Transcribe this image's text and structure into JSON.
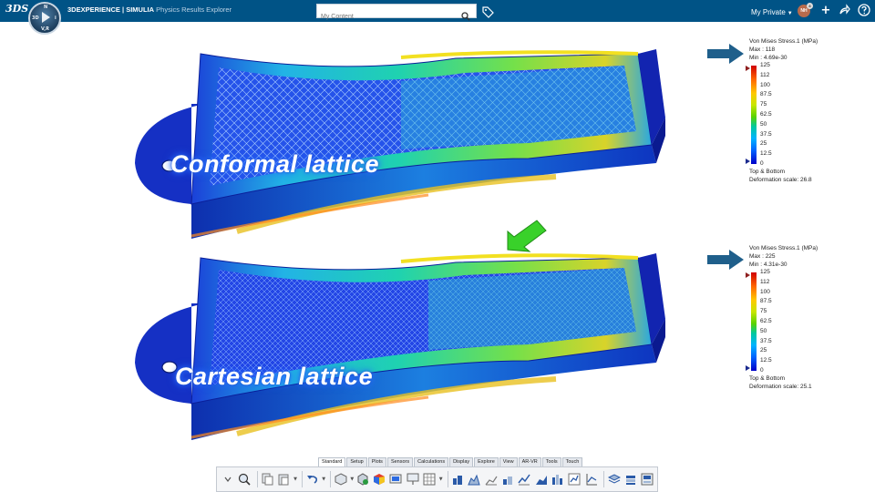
{
  "topbar": {
    "brand": "3DS",
    "compass_labels": {
      "north": "N",
      "left": "3D",
      "right": "i",
      "south": "V,R"
    },
    "title_bold": "3DEXPERIENCE | SIMULIA",
    "title_sub": "Physics Results Explorer",
    "search_placeholder": "My Content",
    "space_label": "My Private",
    "avatar_initials": "NH",
    "avatar_count": "8"
  },
  "viewport": {
    "captions": {
      "top": "Conformal lattice",
      "bottom": "Cartesian lattice"
    },
    "legends": [
      {
        "title": "Von Mises Stress.1 (MPa)",
        "max": "Max : 118",
        "min": "Min : 4.69e-30",
        "ticks": [
          "125",
          "112",
          "100",
          "87.5",
          "75",
          "62.5",
          "50",
          "37.5",
          "25",
          "12.5",
          "0"
        ],
        "footer_1": "Top & Bottom",
        "footer_2": "Deformation scale: 26.8"
      },
      {
        "title": "Von Mises Stress.1 (MPa)",
        "max": "Max : 225",
        "min": "Min : 4.31e-30",
        "ticks": [
          "125",
          "112",
          "100",
          "87.5",
          "75",
          "62.5",
          "50",
          "37.5",
          "25",
          "12.5",
          "0"
        ],
        "footer_1": "Top & Bottom",
        "footer_2": "Deformation scale: 25.1"
      }
    ],
    "colors": {
      "pointer_arrow": "#1f5f8b",
      "highlight_arrow": "#39d12a",
      "lattice": "#3a6cf0"
    }
  },
  "actionbar": {
    "tabs": [
      "Standard",
      "Setup",
      "Plots",
      "Sensors",
      "Calculations",
      "Display",
      "Explore",
      "View",
      "AR-VR",
      "Tools",
      "Touch"
    ],
    "active_tab": "Standard",
    "icons": [
      "collapse-icon",
      "zoom-icon",
      "copy-icon",
      "paste-icon",
      "undo-icon",
      "part-icon",
      "plot-icon",
      "contour-icon",
      "report-icon",
      "presentation-icon",
      "table-icon",
      "bar-chart-icon",
      "histogram-icon",
      "stacked-chart-icon",
      "scatter-icon",
      "line-chart-icon",
      "area-chart-icon",
      "grouped-chart-icon",
      "sensor-chart-icon",
      "xy-plot-icon",
      "layers-icon",
      "stack-icon",
      "export-icon"
    ]
  }
}
